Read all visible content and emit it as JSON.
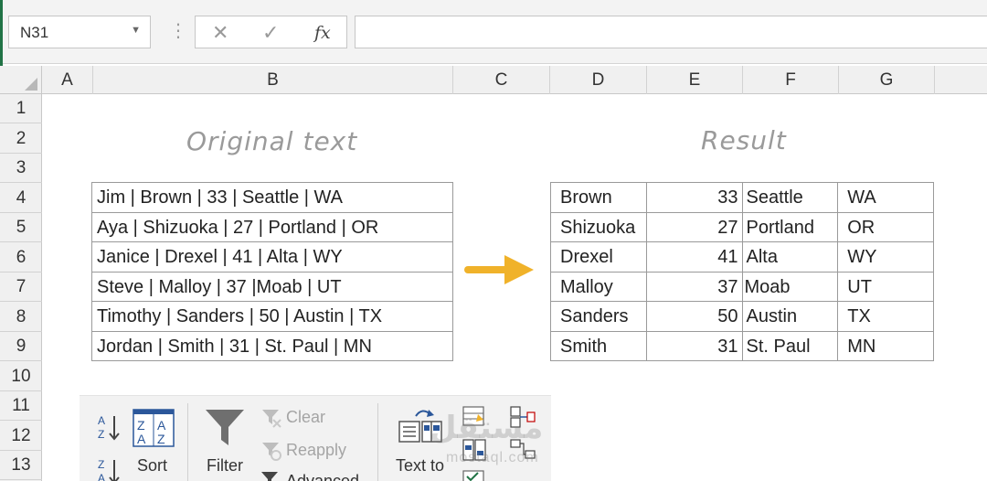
{
  "formula_bar": {
    "name_box": "N31",
    "fx_label": "fx",
    "formula": ""
  },
  "columns": [
    "A",
    "B",
    "C",
    "D",
    "E",
    "F",
    "G"
  ],
  "rows": [
    "1",
    "2",
    "3",
    "4",
    "5",
    "6",
    "7",
    "8",
    "9",
    "10",
    "11",
    "12",
    "13"
  ],
  "titles": {
    "original": "Original text",
    "result": "Result"
  },
  "original_rows": [
    "Jim | Brown | 33 | Seattle | WA",
    "Aya | Shizuoka | 27 | Portland | OR",
    "Janice | Drexel | 41 | Alta | WY",
    "Steve | Malloy | 37 |Moab | UT",
    "Timothy | Sanders | 50 | Austin | TX",
    "Jordan | Smith | 31 | St. Paul | MN"
  ],
  "result_rows": [
    [
      "Brown",
      "33",
      "Seattle",
      "WA"
    ],
    [
      "Shizuoka",
      "27",
      "Portland",
      "OR"
    ],
    [
      "Drexel",
      "41",
      "Alta",
      "WY"
    ],
    [
      "Malloy",
      "37",
      "Moab",
      "UT"
    ],
    [
      "Sanders",
      "50",
      "Austin",
      "TX"
    ],
    [
      "Smith",
      "31",
      "St. Paul",
      "MN"
    ]
  ],
  "ribbon": {
    "sort_label": "Sort",
    "filter_label": "Filter",
    "clear_label": "Clear",
    "reapply_label": "Reapply",
    "advanced_label": "Advanced",
    "text_to_columns_label": "Text to"
  },
  "watermark": {
    "brand": "مستقل",
    "site": "mostaql.com"
  },
  "colors": {
    "arrow": "#f0b22a",
    "excel_green": "#217346",
    "icon_blue": "#2b579a"
  }
}
